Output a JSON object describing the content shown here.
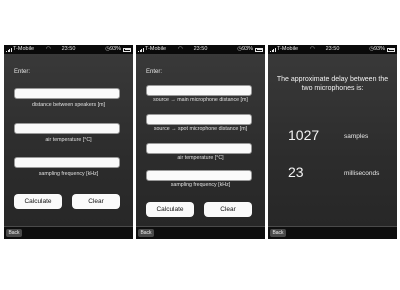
{
  "status": {
    "carrier": "T-Mobile",
    "time": "23:50",
    "battery": "93%"
  },
  "screen1": {
    "prompt": "Enter:",
    "fields": [
      {
        "label": "distance between speakers [m]",
        "value": ""
      },
      {
        "label": "air temperature [°C]",
        "value": ""
      },
      {
        "label": "sampling frequency [kHz]",
        "value": ""
      }
    ],
    "calculate_label": "Calculate",
    "clear_label": "Clear",
    "back_label": "Back"
  },
  "screen2": {
    "prompt": "Enter:",
    "fields": [
      {
        "label": "source → main microphone distance [m]",
        "value": ""
      },
      {
        "label": "source → spot microphone distance [m]",
        "value": ""
      },
      {
        "label": "air temperature [°C]",
        "value": ""
      },
      {
        "label": "sampling frequency [kHz]",
        "value": ""
      }
    ],
    "calculate_label": "Calculate",
    "clear_label": "Clear",
    "back_label": "Back"
  },
  "screen3": {
    "title": "The approximate delay between the two microphones is:",
    "samples_value": "1027",
    "samples_unit": "samples",
    "ms_value": "23",
    "ms_unit": "milliseconds",
    "back_label": "Back"
  },
  "colors": {
    "screen_bg": "#2f2f2f",
    "statusbar_bg": "#0a0a0a",
    "text": "#e8e8e8",
    "field_bg": "#fafafa"
  },
  "icons": [
    "signal-bars-icon",
    "wifi-icon",
    "alarm-icon",
    "battery-icon"
  ]
}
